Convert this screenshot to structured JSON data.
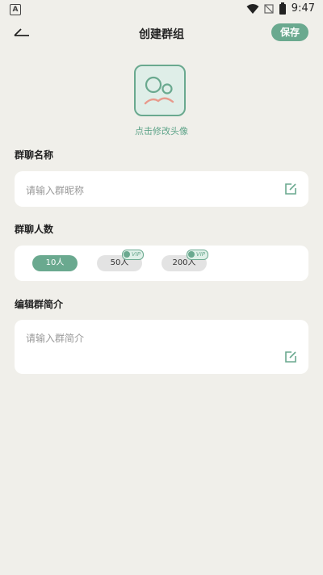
{
  "status_bar": {
    "time": "9:47",
    "app_badge": "A"
  },
  "header": {
    "title": "创建群组",
    "save_label": "保存"
  },
  "avatar": {
    "hint": "点击修改头像"
  },
  "group_name": {
    "label": "群聊名称",
    "placeholder": "请输入群昵称"
  },
  "group_size": {
    "label": "群聊人数",
    "options": [
      {
        "label": "10人",
        "selected": true,
        "vip": false
      },
      {
        "label": "50人",
        "selected": false,
        "vip": true
      },
      {
        "label": "200人",
        "selected": false,
        "vip": true
      }
    ],
    "vip_badge": "VIP"
  },
  "group_intro": {
    "label": "编辑群简介",
    "placeholder": "请输入群简介"
  },
  "colors": {
    "accent": "#6aa98f",
    "background": "#f0efea",
    "card": "#ffffff"
  }
}
